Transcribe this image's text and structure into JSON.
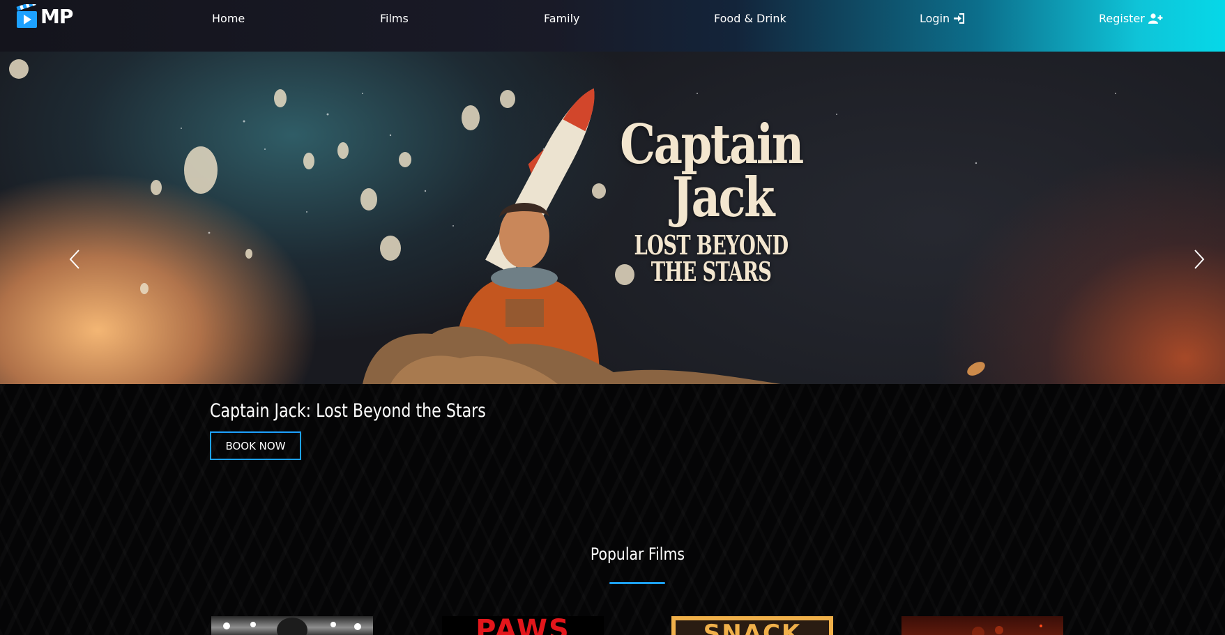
{
  "brand": {
    "logo_text": "MP",
    "accent": "#1da1ff"
  },
  "nav": {
    "items": [
      {
        "label": "Home"
      },
      {
        "label": "Films"
      },
      {
        "label": "Family"
      },
      {
        "label": "Food & Drink"
      },
      {
        "label": "Login",
        "icon": "login-icon"
      },
      {
        "label": "Register",
        "icon": "user-plus-icon"
      }
    ]
  },
  "hero": {
    "art_title_line1": "Captain",
    "art_title_line2": "Jack",
    "art_subtitle_line1": "LOST BEYOND",
    "art_subtitle_line2": "THE STARS",
    "prev_icon": "chevron-left-icon",
    "next_icon": "chevron-right-icon"
  },
  "caption": {
    "title": "Captain Jack: Lost Beyond the Stars",
    "button_label": "BOOK NOW"
  },
  "popular": {
    "title": "Popular Films",
    "posters": [
      {
        "label": ""
      },
      {
        "label": "PAWS"
      },
      {
        "label": "SNACK"
      },
      {
        "label": ""
      }
    ]
  }
}
